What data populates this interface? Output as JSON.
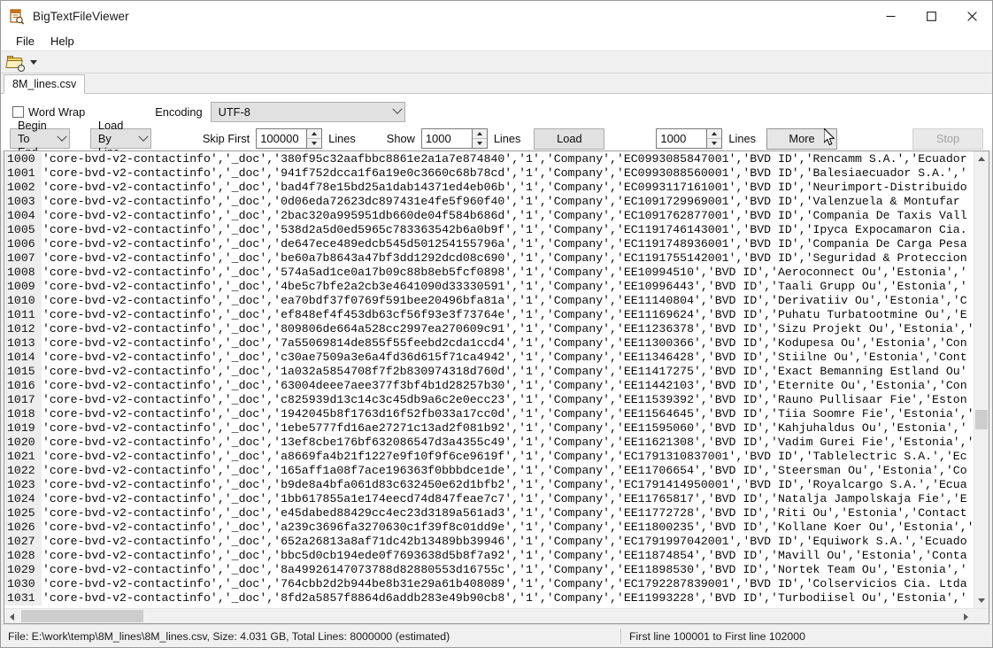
{
  "window": {
    "title": "BigTextFileViewer",
    "app_icon": "file-search-icon",
    "minimize": "—",
    "maximize": "☐",
    "close": "✕"
  },
  "menubar": {
    "items": [
      {
        "label": "File"
      },
      {
        "label": "Help"
      }
    ]
  },
  "toolbar": {
    "open_icon": "open-folder-search-icon",
    "dropdown_icon": "chevron-down-icon"
  },
  "tabs": [
    {
      "label": "8M_lines.csv",
      "active": true
    }
  ],
  "controls": {
    "word_wrap": {
      "label": "Word Wrap",
      "checked": false
    },
    "encoding": {
      "label": "Encoding",
      "value": "UTF-8"
    },
    "direction": {
      "value": "Begin To End"
    },
    "load_mode": {
      "value": "Load By Line"
    },
    "skip_first": {
      "label": "Skip First",
      "value": "100000",
      "unit": "Lines"
    },
    "show": {
      "label": "Show",
      "value": "1000",
      "unit": "Lines"
    },
    "load_button": "Load",
    "more_count": {
      "value": "1000",
      "unit": "Lines"
    },
    "more_button": "More",
    "stop_button": "Stop"
  },
  "viewer": {
    "lines": [
      {
        "no": "1000",
        "text": "'core-bvd-v2-contactinfo','_doc','380f95c32aafbbc8861e2a1a7e874840','1','Company','EC0993085847001','BVD ID','Rencamm S.A.','Ecuador"
      },
      {
        "no": "1001",
        "text": "'core-bvd-v2-contactinfo','_doc','941f752dcca1f6a19e0c3660c68b78cd','1','Company','EC0993088560001','BVD ID','Balesiaecuador S.A.','"
      },
      {
        "no": "1002",
        "text": "'core-bvd-v2-contactinfo','_doc','bad4f78e15bd25a1dab14371ed4eb06b','1','Company','EC0993117161001','BVD ID','Neurimport-Distribuido"
      },
      {
        "no": "1003",
        "text": "'core-bvd-v2-contactinfo','_doc','0d06eda72623dc897431e4fe5f960f40','1','Company','EC1091729969001','BVD ID','Valenzuela & Montufar"
      },
      {
        "no": "1004",
        "text": "'core-bvd-v2-contactinfo','_doc','2bac320a995951db660de04f584b686d','1','Company','EC1091762877001','BVD ID','Compania De Taxis Vall"
      },
      {
        "no": "1005",
        "text": "'core-bvd-v2-contactinfo','_doc','538d2a5d0ed5965c783363542b6a0b9f','1','Company','EC1191746143001','BVD ID','Ipyca Expocamaron Cia."
      },
      {
        "no": "1006",
        "text": "'core-bvd-v2-contactinfo','_doc','de647ece489edcb545d501254155796a','1','Company','EC1191748936001','BVD ID','Compania De Carga Pesa"
      },
      {
        "no": "1007",
        "text": "'core-bvd-v2-contactinfo','_doc','be60a7b8643a47bf3dd1292dcd08c690','1','Company','EC1191755142001','BVD ID','Seguridad & Proteccion"
      },
      {
        "no": "1008",
        "text": "'core-bvd-v2-contactinfo','_doc','574a5ad1ce0a17b09c88b8eb5fcf0898','1','Company','EE10994510','BVD ID','Aeroconnect Ou','Estonia','"
      },
      {
        "no": "1009",
        "text": "'core-bvd-v2-contactinfo','_doc','4be5c7bfe2a2cb3e4641090d33330591','1','Company','EE10996443','BVD ID','Taali Grupp Ou','Estonia','"
      },
      {
        "no": "1010",
        "text": "'core-bvd-v2-contactinfo','_doc','ea70bdf37f0769f591bee20496bfa81a','1','Company','EE11140804','BVD ID','Derivatiiv Ou','Estonia','C"
      },
      {
        "no": "1011",
        "text": "'core-bvd-v2-contactinfo','_doc','ef848ef4f453db63cf56f93e3f73764e','1','Company','EE11169624','BVD ID','Puhatu Turbatootmine Ou','E"
      },
      {
        "no": "1012",
        "text": "'core-bvd-v2-contactinfo','_doc','809806de664a528cc2997ea270609c91','1','Company','EE11236378','BVD ID','Sizu Projekt Ou','Estonia','"
      },
      {
        "no": "1013",
        "text": "'core-bvd-v2-contactinfo','_doc','7a55069814de855f55feebd2cda1ccd4','1','Company','EE11300366','BVD ID','Kodupesa Ou','Estonia','Con"
      },
      {
        "no": "1014",
        "text": "'core-bvd-v2-contactinfo','_doc','c30ae7509a3e6a4fd36d615f71ca4942','1','Company','EE11346428','BVD ID','Stiilne Ou','Estonia','Cont"
      },
      {
        "no": "1015",
        "text": "'core-bvd-v2-contactinfo','_doc','1a032a5854708f7f2b830974318d760d','1','Company','EE11417275','BVD ID','Exact Bemanning Estland Ou'"
      },
      {
        "no": "1016",
        "text": "'core-bvd-v2-contactinfo','_doc','63004deee7aee377f3bf4b1d28257b30','1','Company','EE11442103','BVD ID','Eternite Ou','Estonia','Con"
      },
      {
        "no": "1017",
        "text": "'core-bvd-v2-contactinfo','_doc','c825939d13c14c3c45db9a6c2e0ecc23','1','Company','EE11539392','BVD ID','Rauno Pullisaar Fie','Eston"
      },
      {
        "no": "1018",
        "text": "'core-bvd-v2-contactinfo','_doc','1942045b8f1763d16f52fb033a17cc0d','1','Company','EE11564645','BVD ID','Tiia Soomre Fie','Estonia','"
      },
      {
        "no": "1019",
        "text": "'core-bvd-v2-contactinfo','_doc','1ebe5777fd16ae27271c13ad2f081b92','1','Company','EE11595060','BVD ID','Kahjuhaldus Ou','Estonia','"
      },
      {
        "no": "1020",
        "text": "'core-bvd-v2-contactinfo','_doc','13ef8cbe176bf632086547d3a4355c49','1','Company','EE11621308','BVD ID','Vadim Gurei Fie','Estonia','"
      },
      {
        "no": "1021",
        "text": "'core-bvd-v2-contactinfo','_doc','a8669fa4b21f1227e9f10f9f6ce9619f','1','Company','EC1791310837001','BVD ID','Tablelectric S.A.','Ec"
      },
      {
        "no": "1022",
        "text": "'core-bvd-v2-contactinfo','_doc','165aff1a08f7ace196363f0bbbdce1de','1','Company','EE11706654','BVD ID','Steersman Ou','Estonia','Co"
      },
      {
        "no": "1023",
        "text": "'core-bvd-v2-contactinfo','_doc','b9de8a4bfa061d83c632450e62d1bfb2','1','Company','EC1791414950001','BVD ID','Royalcargo S.A.','Ecua"
      },
      {
        "no": "1024",
        "text": "'core-bvd-v2-contactinfo','_doc','1bb617855a1e174eecd74d847feae7c7','1','Company','EE11765817','BVD ID','Natalja Jampolskaja Fie','E"
      },
      {
        "no": "1025",
        "text": "'core-bvd-v2-contactinfo','_doc','e45dabed88429cc4ec23d3189a561ad3','1','Company','EE11772728','BVD ID','Riti Ou','Estonia','Contact"
      },
      {
        "no": "1026",
        "text": "'core-bvd-v2-contactinfo','_doc','a239c3696fa3270630c1f39f8c01dd9e','1','Company','EE11800235','BVD ID','Kollane Koer Ou','Estonia','"
      },
      {
        "no": "1027",
        "text": "'core-bvd-v2-contactinfo','_doc','652a26813a8af71dc42b13489bb39946','1','Company','EC1791997042001','BVD ID','Equiwork S.A.','Ecuado"
      },
      {
        "no": "1028",
        "text": "'core-bvd-v2-contactinfo','_doc','bbc5d0cb194ede0f7693638d5b8f7a92','1','Company','EE11874854','BVD ID','Mavill Ou','Estonia','Conta"
      },
      {
        "no": "1029",
        "text": "'core-bvd-v2-contactinfo','_doc','8a49926147073788d82880553d16755c','1','Company','EE11898530','BVD ID','Nortek Team Ou','Estonia','"
      },
      {
        "no": "1030",
        "text": "'core-bvd-v2-contactinfo','_doc','764cbb2d2b944be8b31e29a61b408089','1','Company','EC1792287839001','BVD ID','Colservicios Cia. Ltda"
      },
      {
        "no": "1031",
        "text": "'core-bvd-v2-contactinfo','_doc','8fd2a5857f8864d6addb283e49b90cb8','1','Company','EE11993228','BVD ID','Turbodiisel Ou','Estonia','"
      }
    ]
  },
  "statusbar": {
    "left": "File: E:\\work\\temp\\8M_lines\\8M_lines.csv, Size:   4.031 GB, Total Lines: 8000000 (estimated)",
    "right": "First line 100001 to First line 102000"
  },
  "colors": {
    "window_bg": "#f0f0f0",
    "control_face": "#e1e1e1",
    "gutter": "#ededed",
    "scroll_thumb": "#cdcdcd",
    "text": "#0a0a0a"
  }
}
